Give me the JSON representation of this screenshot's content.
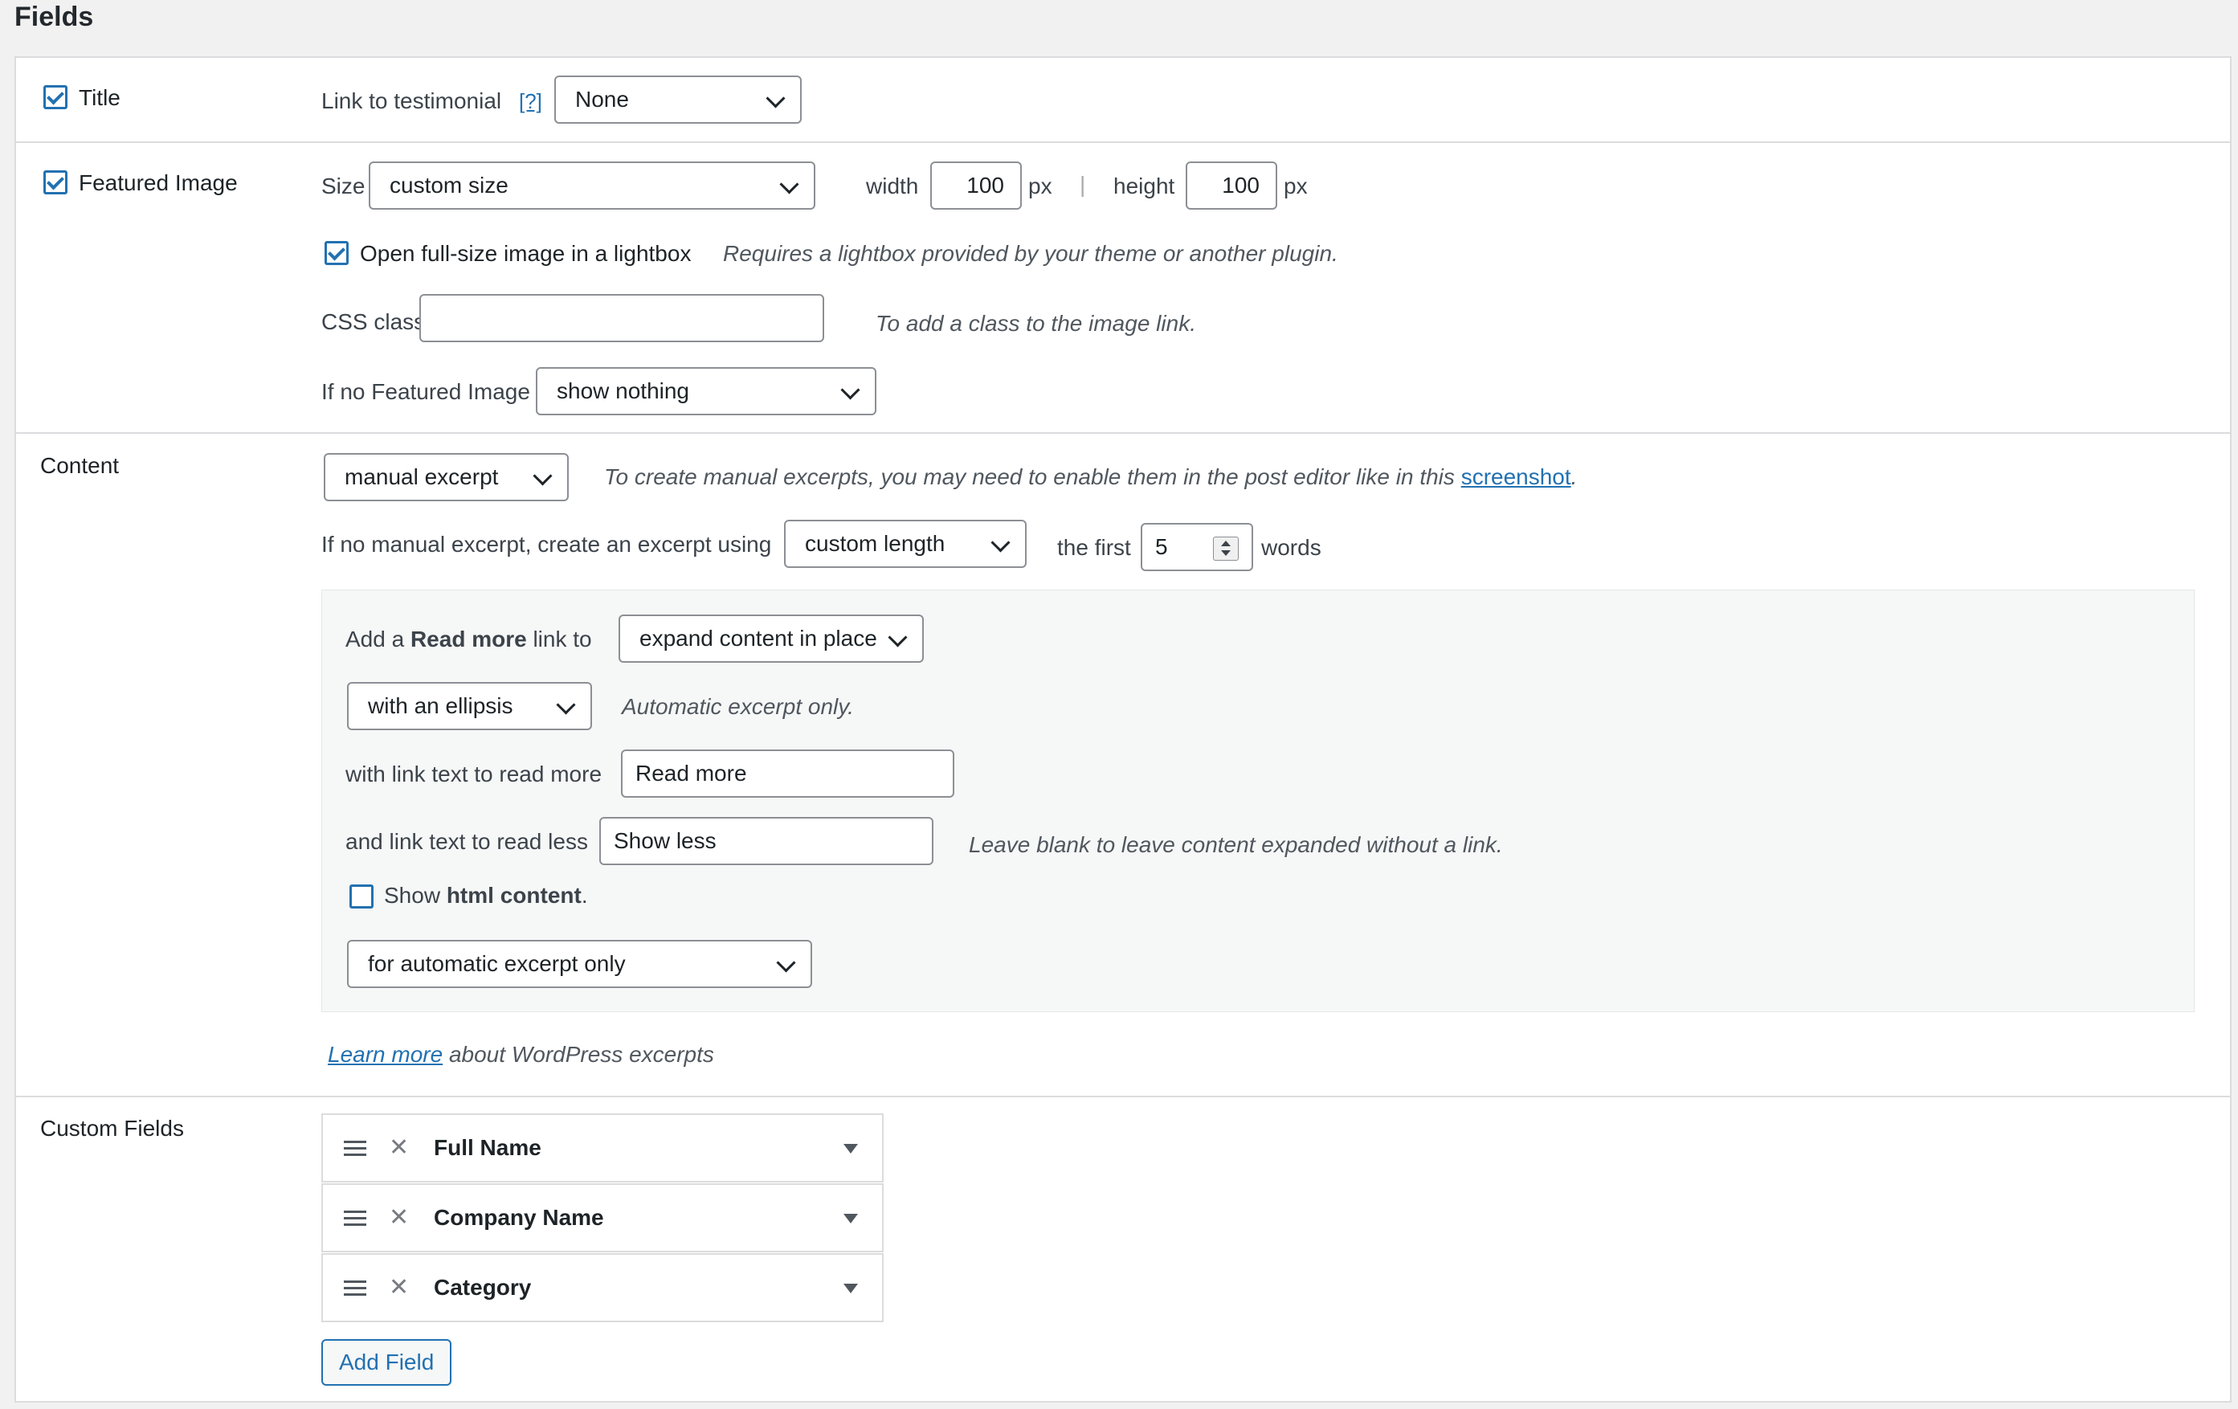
{
  "page": {
    "title": "Fields"
  },
  "title_row": {
    "checkbox_label": "Title",
    "link_label": "Link to testimonial",
    "help": "[?]",
    "link_select": "None"
  },
  "image_row": {
    "checkbox_label": "Featured Image",
    "size_label": "Size",
    "size_select": "custom size",
    "width_label": "width",
    "width_value": "100",
    "px1": "px",
    "divider": "|",
    "height_label": "height",
    "height_value": "100",
    "px2": "px",
    "lightbox_label": "Open full-size image in a lightbox",
    "lightbox_note": "Requires a lightbox provided by your theme or another plugin.",
    "css_label": "CSS class",
    "css_value": "",
    "css_note": "To add a class to the image link.",
    "nofeat_label": "If no Featured Image",
    "nofeat_select": "show nothing"
  },
  "content_row": {
    "label": "Content",
    "content_select": "manual excerpt",
    "note_prefix": "To create manual excerpts, you may need to enable them in the post editor like in this ",
    "note_link": "screenshot",
    "note_suffix": ".",
    "nomanual_label": "If no manual excerpt, create an excerpt using",
    "length_select": "custom length",
    "first_label": "the first",
    "words_value": "5",
    "words_label": "words",
    "readmore_prefix": "Add a ",
    "readmore_bold": "Read more",
    "readmore_suffix": " link to",
    "readmore_select": "expand content in place",
    "ellipsis_select": "with an ellipsis",
    "auto_note": "Automatic excerpt only.",
    "readmore_text_label": "with link text to read more",
    "readmore_text_value": "Read more",
    "readless_label": "and link text to read less",
    "readless_value": "Show less",
    "readless_note": "Leave blank to leave content expanded without a link.",
    "html_prefix": "Show ",
    "html_bold": "html content",
    "html_suffix": ".",
    "html_select": "for automatic excerpt only",
    "learn_link": "Learn more",
    "learn_suffix": " about WordPress excerpts"
  },
  "custom_fields": {
    "label": "Custom Fields",
    "items": [
      {
        "name": "Full Name"
      },
      {
        "name": "Company Name"
      },
      {
        "name": "Category"
      }
    ],
    "add_button": "Add Field"
  },
  "colors": {
    "accent": "#2271b1",
    "border": "#dcdcde",
    "background": "#f1f1f1"
  },
  "icons": [
    "checkbox-checked",
    "chevron-down-icon",
    "drag-handle-icon",
    "close-icon",
    "triangle-down-icon",
    "spinner-arrows-icon"
  ]
}
